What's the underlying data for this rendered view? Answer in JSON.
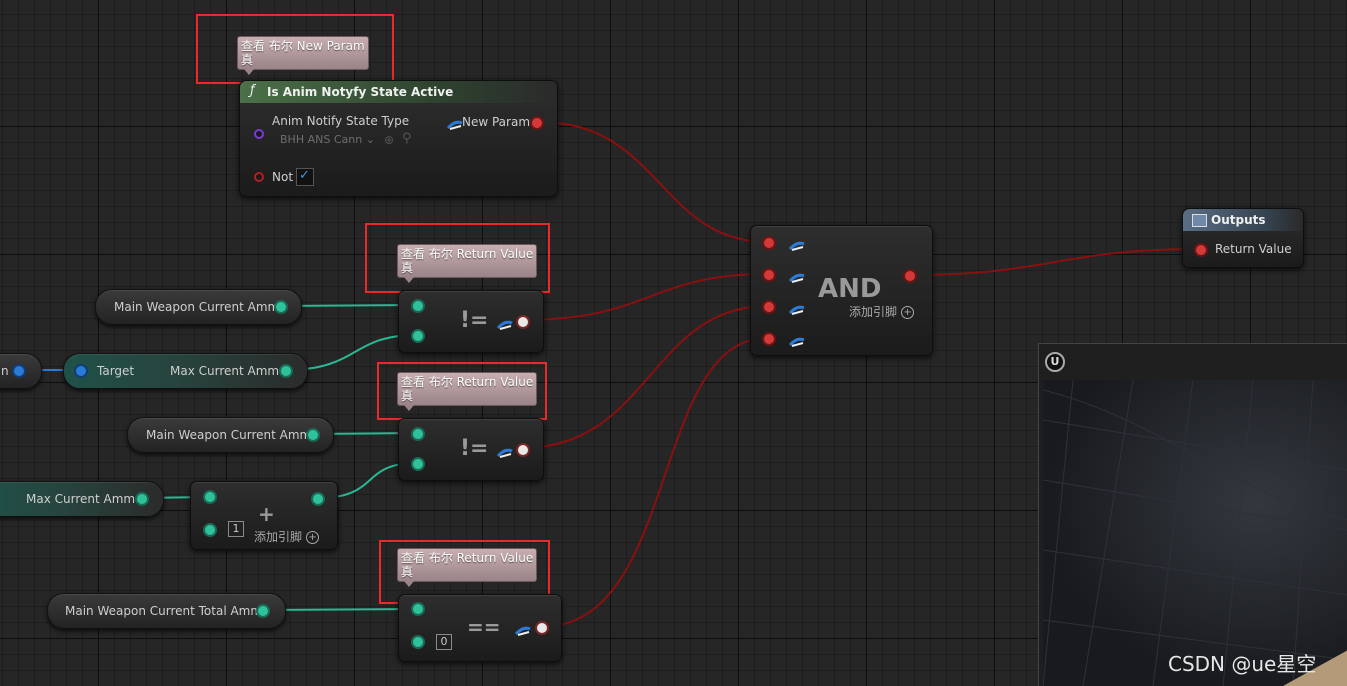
{
  "tooltips": [
    {
      "line1": "查看 布尔 New Param",
      "line2": "真"
    },
    {
      "line1": "查看 布尔 Return Value",
      "line2": "真"
    },
    {
      "line1": "查看 布尔 Return Value",
      "line2": "真"
    },
    {
      "line1": "查看 布尔 Return Value",
      "line2": "真"
    }
  ],
  "func_node": {
    "icon": "ƒ",
    "title": "Is Anim Notyfy State Active",
    "param1_label": "Anim Notify State Type",
    "param1_value": "BHH ANS Cann",
    "output_label": "New Param",
    "not_label": "Not",
    "not_checked": true,
    "header_color": "#3d5a3a"
  },
  "variables": {
    "main_weapon_ammo_1": "Main Weapon Current Ammo",
    "target_label": "Target",
    "max_ammo_1": "Max Current Ammo",
    "main_weapon_ammo_2": "Main Weapon Current Ammo",
    "max_ammo_2": "Max Current Ammo",
    "total_ammo": "Main Weapon Current Total Ammo",
    "left_cut_text": "n"
  },
  "operators": {
    "neq_1": "!=",
    "neq_2": "!=",
    "eq": "==",
    "plus": "+",
    "plus_default": "1",
    "eq_default": "0",
    "add_pin_plus": "添加引脚"
  },
  "and_node": {
    "title": "AND",
    "add_pin": "添加引脚",
    "add_symbol": "+"
  },
  "outputs_node": {
    "title": "Outputs",
    "return_label": "Return Value"
  },
  "viewport": {
    "logo": "U"
  },
  "watermark": "CSDN @ue星空",
  "colors": {
    "teal_pin": "#2fc29a",
    "bool_pin": "#d23a3a",
    "wire_red": "#8a1010",
    "wire_teal": "#28b895",
    "highlight_box": "#e82a2a",
    "tooltip_bg": "#b39a9d"
  }
}
